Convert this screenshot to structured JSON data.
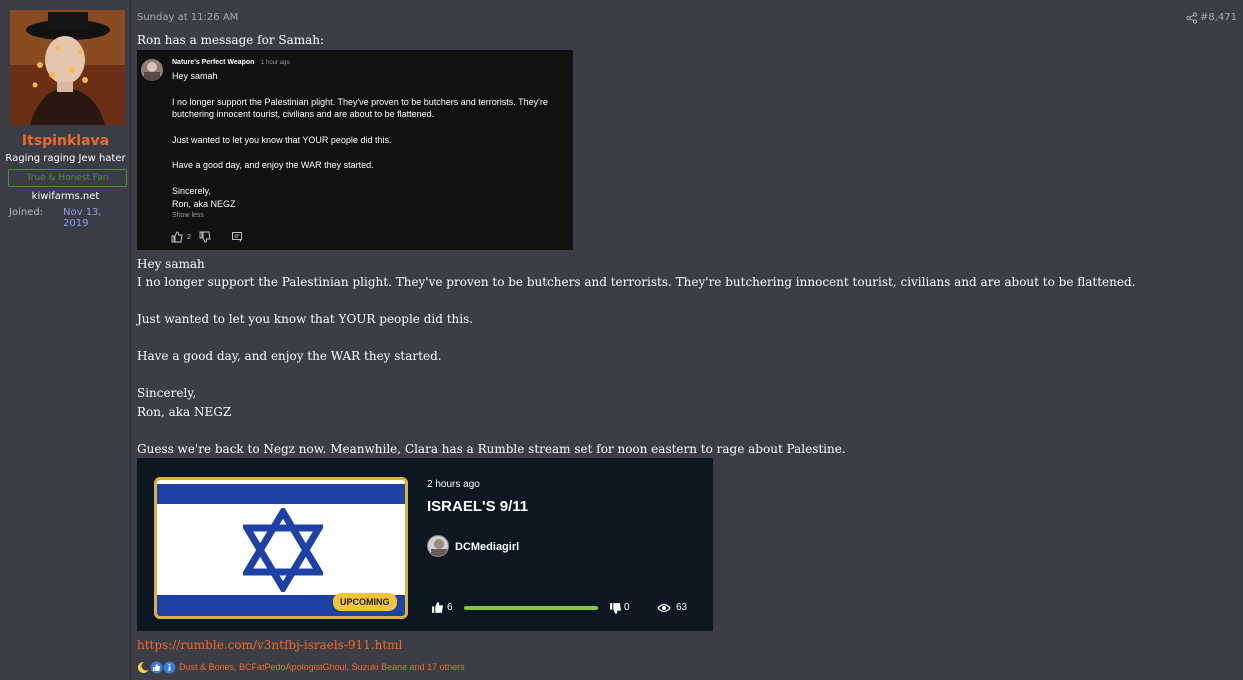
{
  "user": {
    "name": "Itspinklava",
    "title": "Raging raging Jew hater",
    "banner": "True & Honest Fan",
    "site": "kiwifarms.net",
    "joined_label": "Joined:",
    "joined_value": "Nov 13, 2019"
  },
  "post": {
    "timestamp": "Sunday at 11:26 AM",
    "number": "#8,471",
    "intro": "Ron has a message for Samah:",
    "body_lines": [
      "Hey samah",
      "I no longer support the Palestinian plight. They've proven to be butchers and terrorists. They're butchering innocent tourist, civilians and are about to be flattened.",
      "Just wanted to let you know that YOUR people did this.",
      "Have a good day, and enjoy the WAR they started.",
      "Sincerely,",
      "Ron, aka NEGZ",
      "Guess we're back to Negz now. Meanwhile, Clara has a Rumble stream set for noon eastern to rage about Palestine."
    ],
    "link": "https://rumble.com/v3ntfbj-israels-911.html",
    "reactions_text": "Dust & Bones, BCFatPedoApologistGhoul, Suzuki Beane and 17 others"
  },
  "yt_comment": {
    "author": "Nature's Perfect Weapon",
    "time": "1 hour ago",
    "lines": [
      "Hey samah",
      "I no longer support the Palestinian plight. They've proven to be butchers and terrorists. They're",
      "butchering innocent tourist, civilians and are about to be flattened.",
      "Just wanted to let you know that YOUR people did this.",
      "Have a good day, and enjoy the WAR they started.",
      "Sincerely,",
      "Ron, aka NEGZ"
    ],
    "show_less": "Show less",
    "like_count": "2"
  },
  "rumble": {
    "time": "2 hours ago",
    "title": "ISRAEL'S 9/11",
    "channel": "DCMediagirl",
    "badge": "UPCOMING",
    "likes": "6",
    "dislikes": "0",
    "views": "63",
    "like_fraction": 1.0
  },
  "colors": {
    "accent": "#f0692a",
    "rumble_green": "#85c742",
    "flag_blue": "#1e41a8",
    "badge_yellow": "#f1c43a"
  }
}
